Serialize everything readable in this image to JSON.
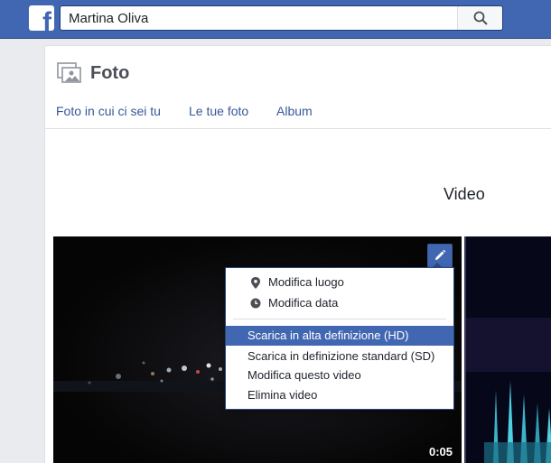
{
  "topbar": {
    "logo_letter": "f",
    "search_value": "Martina Oliva",
    "search_icon": "search-icon"
  },
  "panel": {
    "title": "Foto",
    "title_icon": "photos-icon",
    "tabs": [
      {
        "label": "Foto in cui ci sei tu"
      },
      {
        "label": "Le tue foto"
      },
      {
        "label": "Album"
      }
    ],
    "section_title": "Video"
  },
  "video": {
    "duration": "0:05",
    "edit_icon": "pencil-icon"
  },
  "menu": {
    "items": [
      {
        "label": "Modifica luogo",
        "icon": "location-pin-icon"
      },
      {
        "label": "Modifica data",
        "icon": "clock-icon"
      },
      {
        "label": "Scarica in alta definizione (HD)",
        "highlighted": true
      },
      {
        "label": "Scarica in definizione standard (SD)"
      },
      {
        "label": "Modifica questo video"
      },
      {
        "label": "Elimina video"
      }
    ]
  },
  "colors": {
    "brand": "#4267b2",
    "link": "#365899",
    "background": "#e9ebee"
  }
}
